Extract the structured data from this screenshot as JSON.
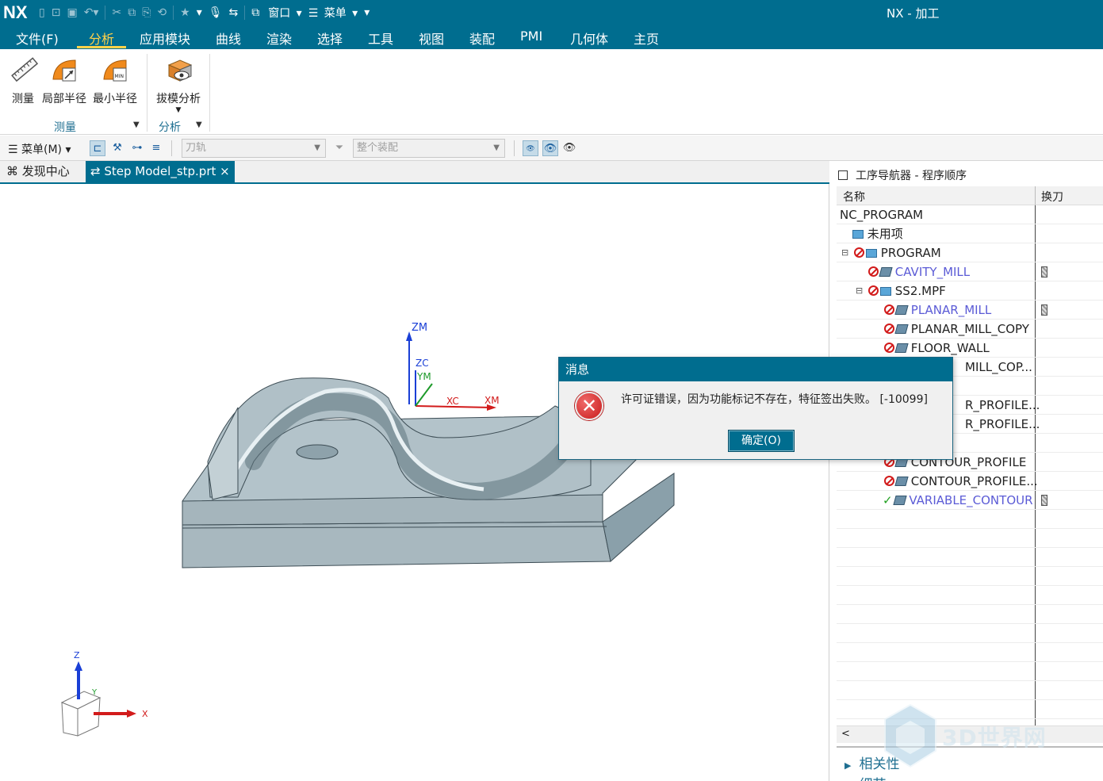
{
  "app": {
    "logo": "NX",
    "title": "NX - 加工"
  },
  "quick_access": {
    "window_label": "窗口",
    "menu_label": "菜单"
  },
  "menu_tabs": [
    {
      "label": "文件(F)"
    },
    {
      "label": "分析",
      "active": true
    },
    {
      "label": "应用模块"
    },
    {
      "label": "曲线"
    },
    {
      "label": "渲染"
    },
    {
      "label": "选择"
    },
    {
      "label": "工具"
    },
    {
      "label": "视图"
    },
    {
      "label": "装配"
    },
    {
      "label": "PMI"
    },
    {
      "label": "几何体"
    },
    {
      "label": "主页"
    }
  ],
  "ribbon": {
    "buttons": [
      {
        "label": "测量",
        "icon": "ruler-icon"
      },
      {
        "label": "局部半径",
        "icon": "local-radius-icon"
      },
      {
        "label": "最小半径",
        "icon": "min-radius-icon"
      },
      {
        "label": "拔模分析",
        "icon": "draft-analysis-icon"
      }
    ],
    "groups": [
      {
        "label": "测量"
      },
      {
        "label": "分析"
      }
    ]
  },
  "toolbar2": {
    "menu_label": "菜单(M)",
    "combo1_placeholder": "刀轨",
    "combo2_placeholder": "整个装配"
  },
  "doc_tabs": [
    {
      "label": "发现中心"
    },
    {
      "label": "Step Model_stp.prt",
      "active": true,
      "close": "×"
    }
  ],
  "viewport": {
    "wcs_labels": {
      "zm": "ZM",
      "zc": "ZC",
      "ym": "YM",
      "xc": "XC",
      "xm": "XM"
    },
    "triad_labels": {
      "z": "Z",
      "y": "Y",
      "x": "X"
    }
  },
  "navigator": {
    "title": "工序导航器 - 程序顺序",
    "col_name": "名称",
    "col_tool": "换刀",
    "rows": [
      {
        "label": "NC_PROGRAM",
        "indent": 0,
        "status": "",
        "icon": ""
      },
      {
        "label": "未用项",
        "indent": 1,
        "status": "",
        "icon": "folder"
      },
      {
        "label": "PROGRAM",
        "indent": 1,
        "status": "no",
        "icon": "folder",
        "expanded": true
      },
      {
        "label": "CAVITY_MILL",
        "indent": 2,
        "status": "no",
        "icon": "op",
        "blue": true,
        "tool": true
      },
      {
        "label": "SS2.MPF",
        "indent": 2,
        "status": "no",
        "icon": "folder",
        "expanded": true
      },
      {
        "label": "PLANAR_MILL",
        "indent": 3,
        "status": "no",
        "icon": "op",
        "blue": true,
        "tool": true
      },
      {
        "label": "PLANAR_MILL_COPY",
        "indent": 3,
        "status": "no",
        "icon": "op"
      },
      {
        "label": "FLOOR_WALL",
        "indent": 3,
        "status": "no",
        "icon": "op"
      },
      {
        "label": "MILL_COP...",
        "indent": 3,
        "status": "",
        "icon": "",
        "partial": true
      },
      {
        "label": "",
        "indent": 3,
        "status": "",
        "icon": ""
      },
      {
        "label": "R_PROFILE...",
        "indent": 3,
        "status": "",
        "icon": "",
        "partial": true
      },
      {
        "label": "R_PROFILE...",
        "indent": 3,
        "status": "",
        "icon": "",
        "partial": true
      },
      {
        "label": "",
        "indent": 3,
        "status": "",
        "icon": ""
      },
      {
        "label": "CONTOUR_PROFILE",
        "indent": 3,
        "status": "no",
        "icon": "op"
      },
      {
        "label": "CONTOUR_PROFILE...",
        "indent": 3,
        "status": "no",
        "icon": "op"
      },
      {
        "label": "VARIABLE_CONTOUR",
        "indent": 3,
        "status": "ok",
        "icon": "op",
        "blue": true,
        "tool": true
      }
    ],
    "bottom_items": [
      {
        "label": "相关性"
      },
      {
        "label": "细节"
      }
    ]
  },
  "watermark": {
    "text": "3D世界网"
  },
  "dialog": {
    "title": "消息",
    "message": "许可证错误，因为功能标记不存在，特征签出失败。 [-10099]",
    "ok_label": "确定(O)",
    "icon": "error-icon"
  }
}
